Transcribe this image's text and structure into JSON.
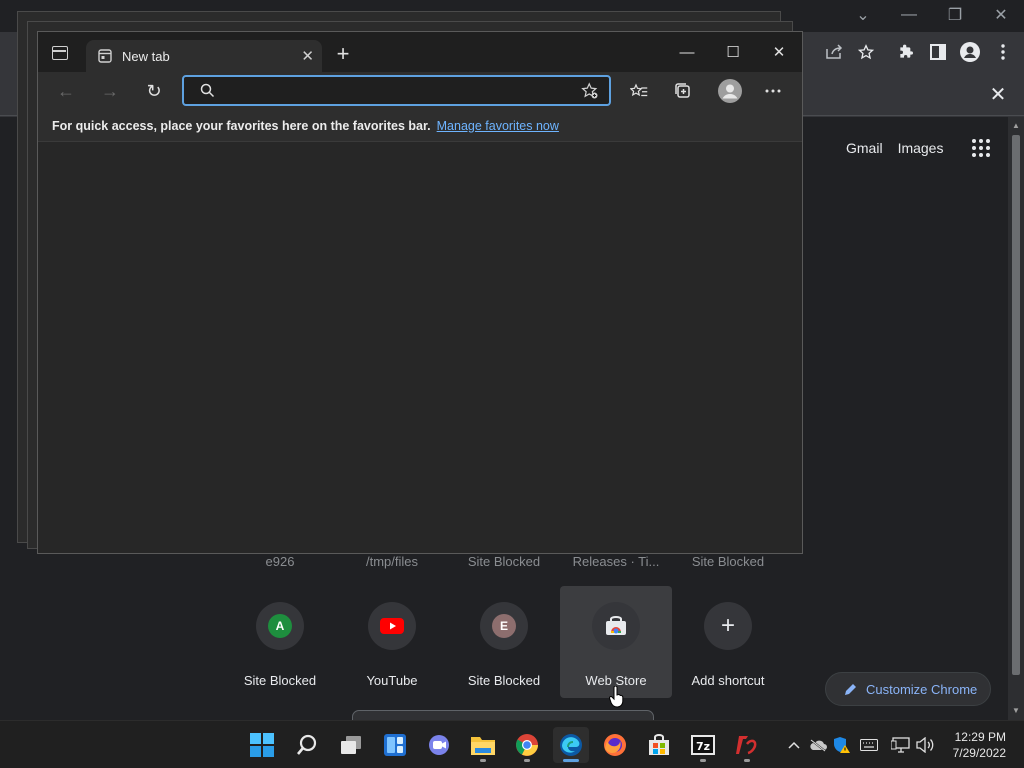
{
  "chrome": {
    "shortcuts_top": [
      "e926",
      "/tmp/files",
      "Site Blocked",
      "Releases · Ti...",
      "Site Blocked"
    ],
    "shortcuts": [
      {
        "label": "Site Blocked",
        "letter": "A",
        "color": "#1e8e3e"
      },
      {
        "label": "YouTube",
        "letter": "",
        "color": "#ff0000"
      },
      {
        "label": "Site Blocked",
        "letter": "E",
        "color": "#8d6e6e"
      },
      {
        "label": "Web Store",
        "letter": "",
        "color": ""
      },
      {
        "label": "Add shortcut",
        "letter": "+",
        "color": ""
      }
    ],
    "gmail": "Gmail",
    "images": "Images",
    "customize_label": "Customize Chrome"
  },
  "edge": {
    "tab_title": "New tab",
    "address_value": "",
    "favbar_message": "For quick access, place your favorites here on the favorites bar.",
    "favbar_link": "Manage favorites now"
  },
  "taskbar": {
    "time": "12:29 PM",
    "date": "7/29/2022"
  },
  "colors": {
    "accent": "#5ea1e0",
    "link": "#8ab4f8"
  }
}
